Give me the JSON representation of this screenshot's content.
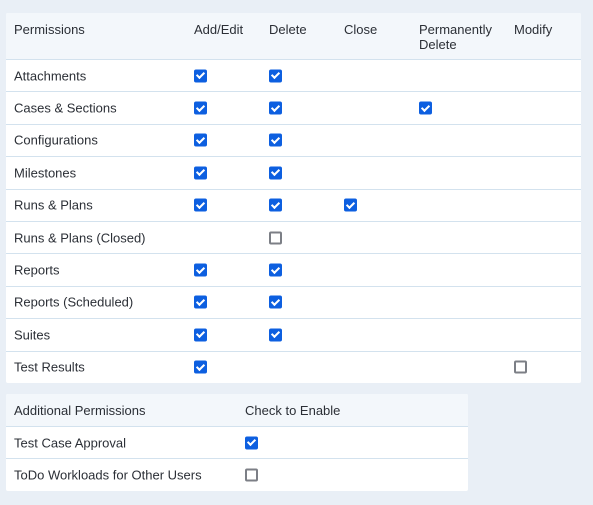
{
  "permissions_table": {
    "columns": [
      "Permissions",
      "Add/Edit",
      "Delete",
      "Close",
      "Permanently Delete",
      "Modify"
    ],
    "column_keys": [
      "add_edit",
      "delete",
      "close",
      "permanently_delete",
      "modify"
    ],
    "rows": [
      {
        "label": "Attachments",
        "add_edit": true,
        "delete": true,
        "close": null,
        "permanently_delete": null,
        "modify": null
      },
      {
        "label": "Cases & Sections",
        "add_edit": true,
        "delete": true,
        "close": null,
        "permanently_delete": true,
        "modify": null
      },
      {
        "label": "Configurations",
        "add_edit": true,
        "delete": true,
        "close": null,
        "permanently_delete": null,
        "modify": null
      },
      {
        "label": "Milestones",
        "add_edit": true,
        "delete": true,
        "close": null,
        "permanently_delete": null,
        "modify": null
      },
      {
        "label": "Runs & Plans",
        "add_edit": true,
        "delete": true,
        "close": true,
        "permanently_delete": null,
        "modify": null
      },
      {
        "label": "Runs & Plans (Closed)",
        "add_edit": null,
        "delete": false,
        "close": null,
        "permanently_delete": null,
        "modify": null
      },
      {
        "label": "Reports",
        "add_edit": true,
        "delete": true,
        "close": null,
        "permanently_delete": null,
        "modify": null
      },
      {
        "label": "Reports (Scheduled)",
        "add_edit": true,
        "delete": true,
        "close": null,
        "permanently_delete": null,
        "modify": null
      },
      {
        "label": "Suites",
        "add_edit": true,
        "delete": true,
        "close": null,
        "permanently_delete": null,
        "modify": null
      },
      {
        "label": "Test Results",
        "add_edit": true,
        "delete": null,
        "close": null,
        "permanently_delete": null,
        "modify": false
      }
    ]
  },
  "additional_table": {
    "columns": [
      "Additional Permissions",
      "Check to Enable"
    ],
    "rows": [
      {
        "label": "Test Case Approval",
        "enabled": true
      },
      {
        "label": "ToDo Workloads for Other Users",
        "enabled": false
      }
    ]
  },
  "colors": {
    "checkbox_checked": "#0d5fe0",
    "checkbox_unchecked_border": "#7c7f86",
    "header_bg": "#f3f7fb",
    "page_bg": "#e9eff6"
  }
}
